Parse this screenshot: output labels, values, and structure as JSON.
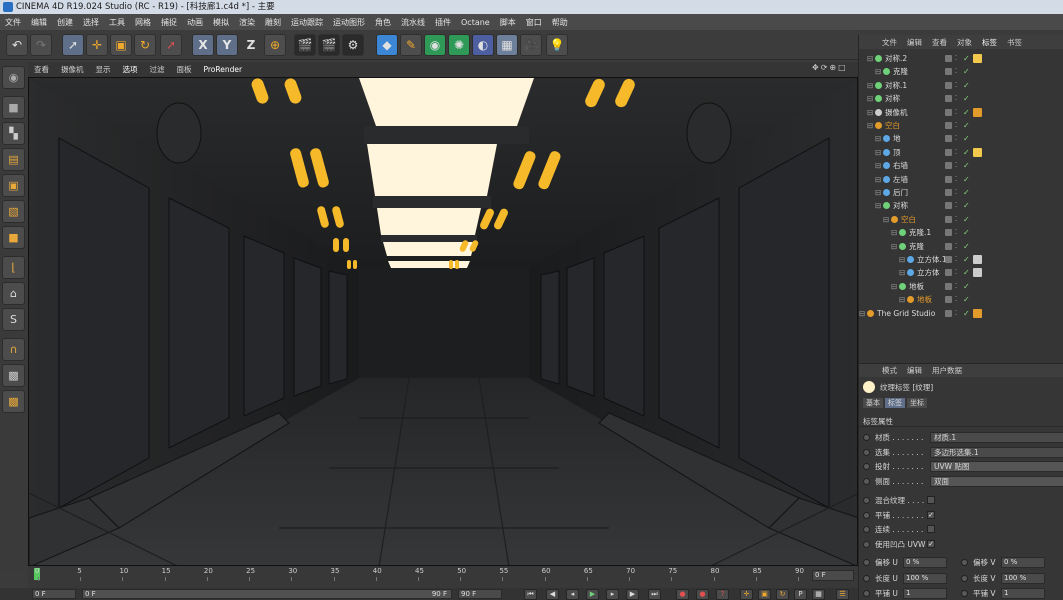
{
  "window": {
    "title": "CINEMA 4D R19.024 Studio (RC - R19) - [科技廊1.c4d *] - 主要"
  },
  "menubar": [
    "文件",
    "编辑",
    "创建",
    "选择",
    "工具",
    "网格",
    "捕捉",
    "动画",
    "模拟",
    "渲染",
    "雕刻",
    "运动跟踪",
    "运动图形",
    "角色",
    "流水线",
    "插件",
    "Octane",
    "脚本",
    "窗口",
    "帮助"
  ],
  "toolbar": {
    "icons": [
      "undo-icon",
      "redo-icon",
      "live-select-icon",
      "move-icon",
      "scale-icon",
      "rotate-icon",
      "recent-tool-icon",
      "x-axis-icon",
      "y-axis-icon",
      "z-axis-icon",
      "coordinate-system-icon",
      "render-view-icon",
      "render-picture-viewer-icon",
      "render-settings-icon",
      "cube-icon",
      "pen-icon",
      "subdivision-icon",
      "array-icon",
      "deformer-icon",
      "floor-icon",
      "camera-icon",
      "light-icon"
    ],
    "axis_labels": [
      "X",
      "Y",
      "Z"
    ]
  },
  "viewport_menu": [
    "查看",
    "摄像机",
    "显示",
    "选项",
    "过滤",
    "面板",
    "ProRender"
  ],
  "object_manager": {
    "tabs": [
      "文件",
      "编辑",
      "查看",
      "对象",
      "标签",
      "书签"
    ],
    "rows": [
      {
        "name": "对称.2",
        "indent": 1,
        "color": "#6fd27a",
        "tag": "#f2c94c"
      },
      {
        "name": "克隆",
        "indent": 2,
        "color": "#6fd27a",
        "tag": ""
      },
      {
        "name": "对称.1",
        "indent": 1,
        "color": "#6fd27a",
        "tag": ""
      },
      {
        "name": "对称",
        "indent": 1,
        "color": "#6fd27a",
        "tag": ""
      },
      {
        "name": "摄像机",
        "indent": 1,
        "color": "#cccccc",
        "tag": "#e39b2c"
      },
      {
        "name": "空白",
        "indent": 1,
        "color": "#e39b2c",
        "tag": ""
      },
      {
        "name": "地",
        "indent": 2,
        "color": "#5fa8e6",
        "tag": ""
      },
      {
        "name": "顶",
        "indent": 2,
        "color": "#5fa8e6",
        "tag": "#f2c94c"
      },
      {
        "name": "右墙",
        "indent": 2,
        "color": "#5fa8e6",
        "tag": ""
      },
      {
        "name": "左墙",
        "indent": 2,
        "color": "#5fa8e6",
        "tag": ""
      },
      {
        "name": "后门",
        "indent": 2,
        "color": "#5fa8e6",
        "tag": ""
      },
      {
        "name": "对称",
        "indent": 2,
        "color": "#6fd27a",
        "tag": ""
      },
      {
        "name": "空白",
        "indent": 3,
        "color": "#e39b2c",
        "tag": ""
      },
      {
        "name": "克隆.1",
        "indent": 4,
        "color": "#6fd27a",
        "tag": ""
      },
      {
        "name": "克隆",
        "indent": 4,
        "color": "#6fd27a",
        "tag": ""
      },
      {
        "name": "立方体.1",
        "indent": 5,
        "color": "#5fa8e6",
        "tag": "#cccccc"
      },
      {
        "name": "立方体",
        "indent": 5,
        "color": "#5fa8e6",
        "tag": "#cccccc"
      },
      {
        "name": "地板",
        "indent": 4,
        "color": "#6fd27a",
        "tag": ""
      },
      {
        "name": "地板",
        "indent": 5,
        "color": "#e39b2c",
        "tag": ""
      },
      {
        "name": "The Grid Studio",
        "indent": 0,
        "color": "#e39b2c",
        "tag": "#e39b2c"
      }
    ]
  },
  "attribute_manager": {
    "tabs": [
      "模式",
      "编辑",
      "用户数据"
    ],
    "header": "纹理标签 [纹理]",
    "subtabs": [
      "基本",
      "标签",
      "坐标"
    ],
    "section": "标签属性",
    "fields": [
      {
        "label": "材质 . . . . . . .",
        "value": "材质.1"
      },
      {
        "label": "选集 . . . . . . .",
        "value": "多边形选集.1"
      },
      {
        "label": "投射 . . . . . . .",
        "value": "UVW 贴图"
      },
      {
        "label": "侧面 . . . . . . .",
        "value": "双面"
      }
    ],
    "checks": [
      {
        "label": "混合纹理 . . . .",
        "checked": false
      },
      {
        "label": "平铺 . . . . . . .",
        "checked": true
      },
      {
        "label": "连续 . . . . . . .",
        "checked": false
      },
      {
        "label": "使用凹凸 UVW",
        "checked": true
      }
    ],
    "offset_u_label": "偏移 U",
    "offset_u": "0 %",
    "offset_v_label": "偏移 V",
    "offset_v": "0 %",
    "length_u_label": "长度 U",
    "length_u": "100 %",
    "length_v_label": "长度 V",
    "length_v": "100 %",
    "tile_u_label": "平铺 U",
    "tile_u": "1",
    "tile_v_label": "平铺 V",
    "tile_v": "1"
  },
  "timeline": {
    "ticks": [
      "0",
      "5",
      "10",
      "15",
      "20",
      "25",
      "30",
      "35",
      "40",
      "45",
      "50",
      "55",
      "60",
      "65",
      "70",
      "75",
      "80",
      "85",
      "90"
    ],
    "current_frame": "0 F",
    "start_field": "0 F",
    "slider_start": "0 F",
    "slider_end": "90 F",
    "end_field": "90 F"
  },
  "colors": {
    "accent": "#5f6f8a",
    "light_warm": "#f5b92a",
    "light_panel": "#fff4dc"
  }
}
